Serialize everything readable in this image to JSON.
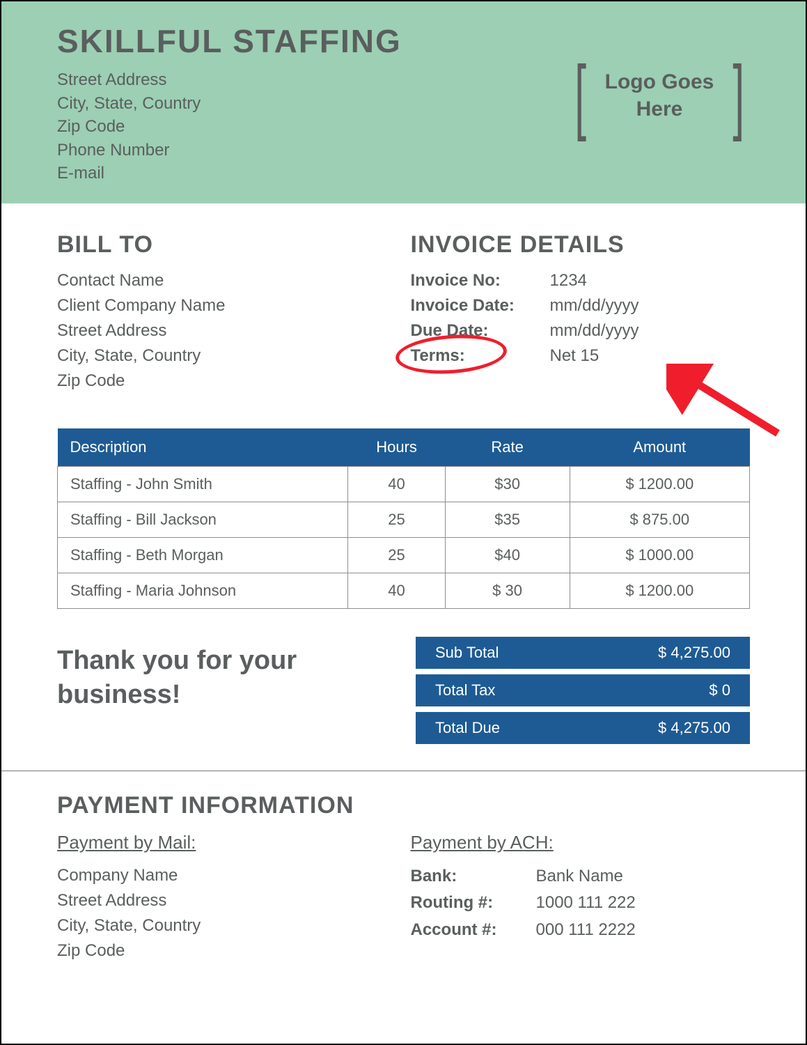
{
  "company": {
    "name": "SKILLFUL STAFFING",
    "street": "Street Address",
    "city": "City, State, Country",
    "zip": "Zip Code",
    "phone": "Phone Number",
    "email": "E-mail",
    "logo_text": "Logo Goes Here"
  },
  "bill_to": {
    "title": "BILL TO",
    "contact": "Contact Name",
    "company": "Client Company Name",
    "street": "Street Address",
    "city": "City, State, Country",
    "zip": "Zip Code"
  },
  "invoice_details": {
    "title": "INVOICE DETAILS",
    "labels": {
      "no": "Invoice No:",
      "date": "Invoice Date:",
      "due": "Due Date:",
      "terms": "Terms:"
    },
    "no": "1234",
    "date": "mm/dd/yyyy",
    "due": "mm/dd/yyyy",
    "terms": "Net 15"
  },
  "table": {
    "headers": {
      "desc": "Description",
      "hours": "Hours",
      "rate": "Rate",
      "amount": "Amount"
    },
    "rows": [
      {
        "desc": "Staffing - John Smith",
        "hours": "40",
        "rate": "$30",
        "amount": "$ 1200.00"
      },
      {
        "desc": "Staffing - Bill Jackson",
        "hours": "25",
        "rate": "$35",
        "amount": "$ 875.00"
      },
      {
        "desc": "Staffing - Beth Morgan",
        "hours": "25",
        "rate": "$40",
        "amount": "$ 1000.00"
      },
      {
        "desc": "Staffing - Maria Johnson",
        "hours": "40",
        "rate": "$ 30",
        "amount": "$ 1200.00"
      }
    ]
  },
  "thanks": "Thank you for your business!",
  "totals": {
    "sub_label": "Sub Total",
    "sub": "$ 4,275.00",
    "tax_label": "Total Tax",
    "tax": "$ 0",
    "due_label": "Total Due",
    "due": "$ 4,275.00"
  },
  "payment": {
    "title": "PAYMENT INFORMATION",
    "mail": {
      "title": "Payment by Mail:",
      "company": "Company Name",
      "street": "Street Address",
      "city": "City, State, Country",
      "zip": "Zip Code"
    },
    "ach": {
      "title": "Payment by ACH:",
      "bank_label": "Bank:",
      "bank": "Bank Name",
      "routing_label": "Routing #:",
      "routing": "1000 111 222",
      "account_label": "Account #:",
      "account": "000 111 2222"
    }
  },
  "annotations": {
    "circle_on": "Terms:",
    "arrow_points_to": "Net 15",
    "arrow_color": "#f01e2c"
  }
}
